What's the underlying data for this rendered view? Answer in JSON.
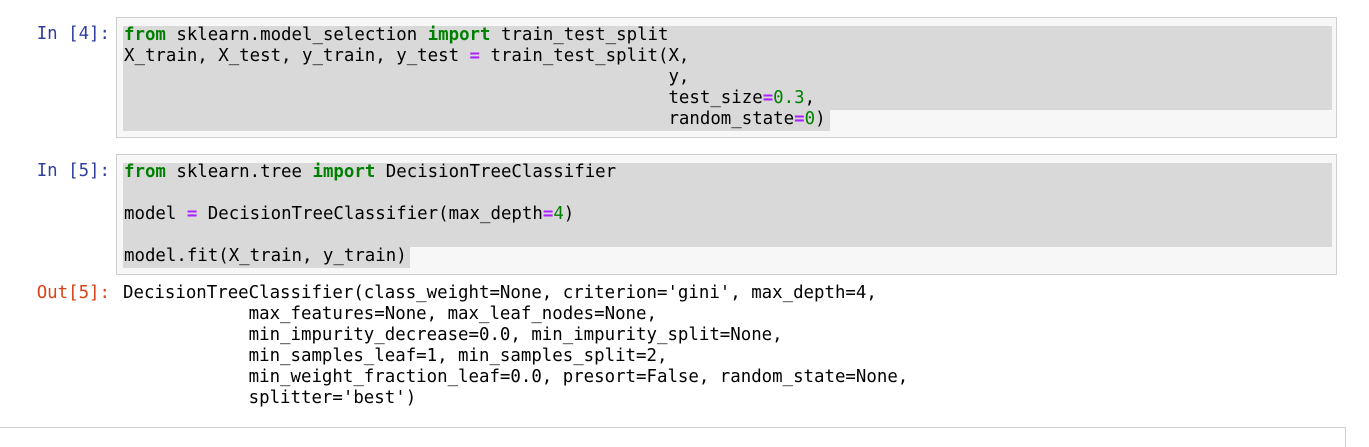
{
  "cells": [
    {
      "prompt": "In [4]:",
      "lines": [
        [
          "from",
          " sklearn.model_selection ",
          "import",
          " train_test_split"
        ],
        [
          "X_train, X_test, y_train, y_test ",
          "=",
          " train_test_split(X,"
        ],
        [
          "                                                    y,"
        ],
        [
          "                                                    test_size",
          "=",
          "0.3",
          ","
        ],
        [
          "                                                    random_state",
          "=",
          "0",
          ")"
        ]
      ]
    },
    {
      "prompt": "In [5]:",
      "lines": [
        [
          "from",
          " sklearn.tree ",
          "import",
          " DecisionTreeClassifier"
        ],
        [
          ""
        ],
        [
          "model ",
          "=",
          " DecisionTreeClassifier(max_depth",
          "=",
          "4",
          ")"
        ],
        [
          ""
        ],
        [
          "model.fit(X_train, y_train)"
        ]
      ],
      "out_prompt": "Out[5]:",
      "output": [
        "DecisionTreeClassifier(class_weight=None, criterion='gini', max_depth=4,",
        "            max_features=None, max_leaf_nodes=None,",
        "            min_impurity_decrease=0.0, min_impurity_split=None,",
        "            min_samples_leaf=1, min_samples_split=2,",
        "            min_weight_fraction_leaf=0.0, presort=False, random_state=None,",
        "            splitter='best')"
      ]
    }
  ],
  "colors": {
    "in_prompt": "#303f9f",
    "out_prompt": "#d84315",
    "keyword": "#008000",
    "operator": "#aa22ff",
    "number": "#008000",
    "selection": "#d9d9d9",
    "cell_bg": "#f7f7f7",
    "cell_border": "#cfcfcf"
  }
}
